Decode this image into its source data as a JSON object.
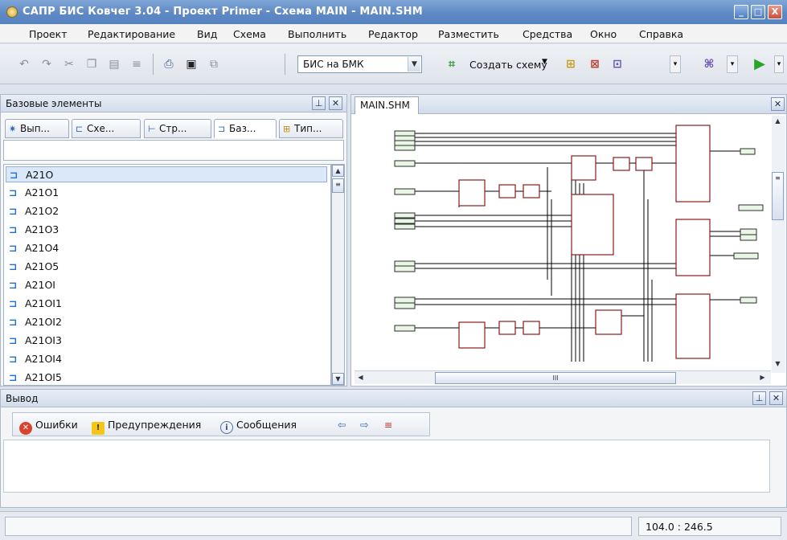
{
  "window": {
    "title": "САПР БИС Ковчег 3.04 - Проект Primer - Схема MAIN - MAIN.SHM",
    "buttons": [
      "_",
      "□",
      "X"
    ]
  },
  "menu": [
    "Проект",
    "Редактирование",
    "Вид",
    "Схема",
    "Выполнить",
    "Редактор",
    "Разместить",
    "Средства",
    "Окно",
    "Справка"
  ],
  "toolbar": {
    "technology_select": "БИС на БМК",
    "create_scheme": "Создать схему"
  },
  "left_panel": {
    "title": "Базовые элементы",
    "tabs": [
      "Вып...",
      "Схе...",
      "Стр...",
      "Баз...",
      "Тип..."
    ],
    "active_tab": 3,
    "elements": [
      "A21O",
      "A21O1",
      "A21O2",
      "A21O3",
      "A21O4",
      "A21O5",
      "A21OI",
      "A21OI1",
      "A21OI2",
      "A21OI3",
      "A21OI4",
      "A21OI5"
    ],
    "selected": 0
  },
  "document": {
    "tab": "MAIN.SHM",
    "scroll_marker": "III"
  },
  "output_panel": {
    "title": "Вывод",
    "filters": [
      "Ошибки",
      "Предупреждения",
      "Сообщения"
    ]
  },
  "status": {
    "coordinates": "104.0 : 246.5"
  },
  "colors": {
    "schematic_lines": "#000000",
    "schematic_blocks": "#8b1a1a",
    "block_fill": "#ffffff",
    "io_fill": "#e9f6e6",
    "titlebar": "#5f88c4"
  }
}
